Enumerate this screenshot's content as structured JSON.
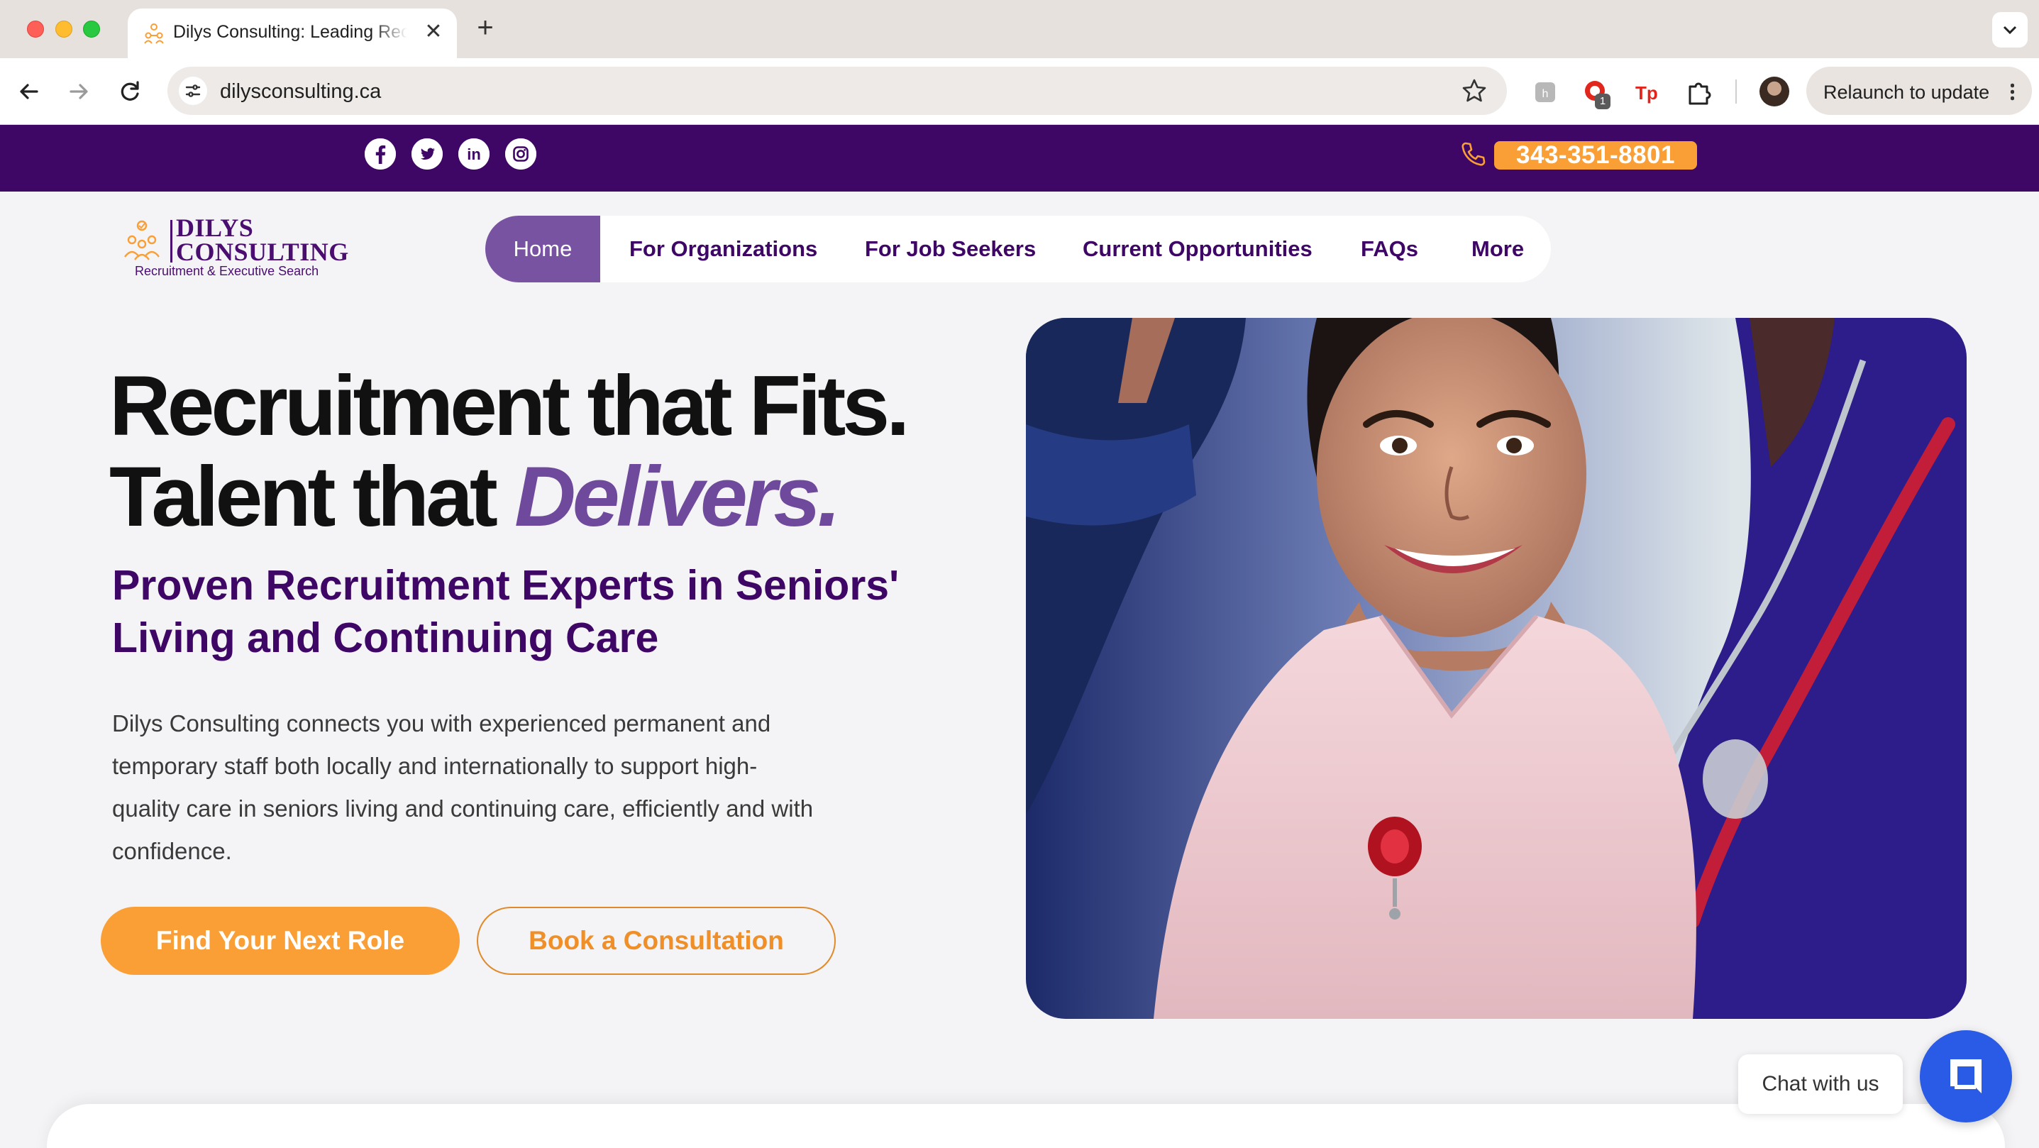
{
  "browser": {
    "tab_title": "Dilys Consulting: Leading Recruitment",
    "tab_close": "✕",
    "new_tab": "+",
    "url": "dilysconsulting.ca",
    "extension_badge": "1",
    "relaunch_label": "Relaunch to update"
  },
  "topbar": {
    "social": [
      "facebook-icon",
      "twitter-icon",
      "linkedin-icon",
      "instagram-icon"
    ],
    "linkedin_text": "in",
    "phone": "343-351-8801"
  },
  "logo": {
    "name_line1": "DILYS",
    "name_line2": "CONSULTING",
    "tagline": "Recruitment & Executive Search"
  },
  "nav": {
    "items": [
      "Home",
      "For Organizations",
      "For Job Seekers",
      "Current Opportunities",
      "FAQs",
      "More"
    ],
    "active": "Home"
  },
  "hero": {
    "headline_line1": "Recruitment that Fits.",
    "headline_line2_plain": "Talent that ",
    "headline_line2_em": "Delivers.",
    "subheading": "Proven Recruitment Experts in Seniors' Living and Continuing Care",
    "lead": "Dilys Consulting connects you with experienced permanent and temporary staff both locally and internationally to support high-quality care in seniors living and continuing care, efficiently and with confidence.",
    "cta_primary": "Find Your Next Role",
    "cta_secondary": "Book a Consultation"
  },
  "chat": {
    "label": "Chat with us"
  },
  "colors": {
    "brand_purple": "#3e0765",
    "accent_purple": "#7853a1",
    "accent_orange": "#f99f36",
    "chat_blue": "#2a5be6"
  }
}
